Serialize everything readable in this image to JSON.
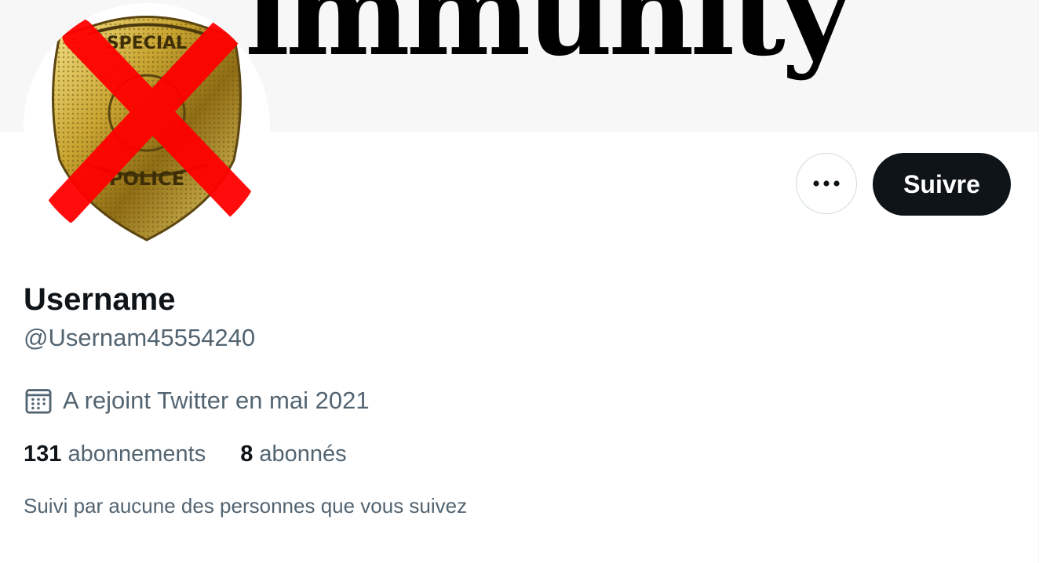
{
  "banner": {
    "text": "immunity"
  },
  "profile": {
    "display_name": "Username",
    "handle": "@Usernam45554240",
    "joined": "A rejoint Twitter en mai 2021",
    "following_count": "131",
    "following_label": "abonnements",
    "followers_count": "8",
    "followers_label": "abonnés",
    "followed_by": "Suivi par aucune des personnes que vous suivez"
  },
  "actions": {
    "follow_label": "Suivre"
  },
  "icons": {
    "more": "more-horizontal-icon",
    "calendar": "calendar-icon"
  },
  "colors": {
    "text_primary": "#0f1419",
    "text_secondary": "#536471",
    "button_dark": "#0f1419",
    "border": "#cfd9de",
    "cross_red": "#ff0000"
  }
}
